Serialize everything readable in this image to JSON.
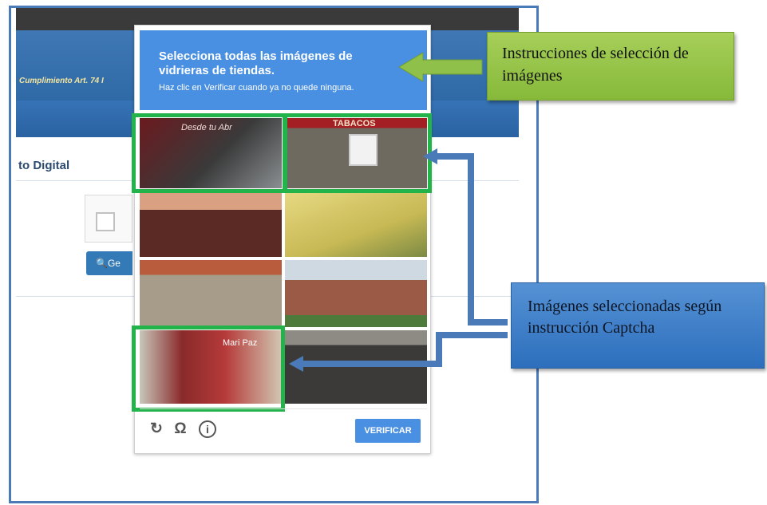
{
  "site": {
    "header_text": "Cumplimiento Art. 74 I",
    "subtitle": "to Digital",
    "button_label": "Ge"
  },
  "captcha": {
    "title": "Selecciona todas las imágenes de vidrieras de tiendas.",
    "subtitle": "Haz clic en Verificar cuando ya no quede ninguna.",
    "tiles": [
      {
        "label": "Desde tu Abr",
        "selected": true
      },
      {
        "label": "TABACOS",
        "selected": true
      },
      {
        "label": "",
        "selected": false
      },
      {
        "label": "",
        "selected": false
      },
      {
        "label": "",
        "selected": false
      },
      {
        "label": "",
        "selected": false
      },
      {
        "label": "Mari Paz",
        "selected": true
      },
      {
        "label": "",
        "selected": false
      }
    ],
    "footer_icons": [
      "reload-icon",
      "headphones-icon",
      "info-icon"
    ],
    "verify_label": "VERIFICAR",
    "accent_color": "#4a90e2",
    "selection_color": "#22b34a"
  },
  "callouts": {
    "instructions": "Instrucciones de selección de imágenes",
    "selected_images": "Imágenes seleccionadas según instrucción Captcha"
  }
}
